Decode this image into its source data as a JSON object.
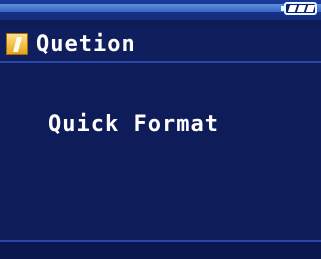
{
  "status": {
    "battery_icon": "battery-icon"
  },
  "dialog": {
    "title_icon": "info-icon",
    "title": "Quetion",
    "message": "Quick Format"
  },
  "colors": {
    "background": "#0e1d5a",
    "status_bar": "#1b3a9a",
    "accent_line": "#2a46a8",
    "text": "#ffffff",
    "icon": "#e6a419"
  }
}
